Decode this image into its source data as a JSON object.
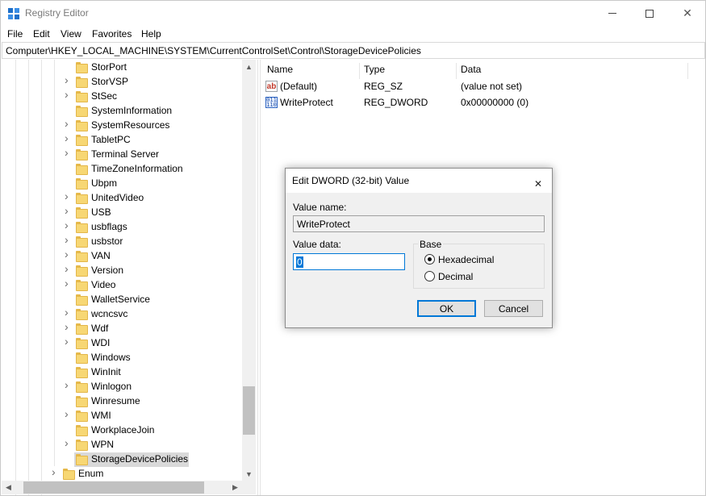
{
  "window": {
    "title": "Registry Editor"
  },
  "titlebar": {
    "minimize_icon": "minimize-icon",
    "maximize_icon": "maximize-icon",
    "close_glyph": "✕"
  },
  "menu": [
    "File",
    "Edit",
    "View",
    "Favorites",
    "Help"
  ],
  "address": "Computer\\HKEY_LOCAL_MACHINE\\SYSTEM\\CurrentControlSet\\Control\\StorageDevicePolicies",
  "tree": {
    "items": [
      {
        "label": "StorPort",
        "expandable": false
      },
      {
        "label": "StorVSP",
        "expandable": true
      },
      {
        "label": "StSec",
        "expandable": true
      },
      {
        "label": "SystemInformation",
        "expandable": false
      },
      {
        "label": "SystemResources",
        "expandable": true
      },
      {
        "label": "TabletPC",
        "expandable": true
      },
      {
        "label": "Terminal Server",
        "expandable": true
      },
      {
        "label": "TimeZoneInformation",
        "expandable": false
      },
      {
        "label": "Ubpm",
        "expandable": false
      },
      {
        "label": "UnitedVideo",
        "expandable": true
      },
      {
        "label": "USB",
        "expandable": true
      },
      {
        "label": "usbflags",
        "expandable": true
      },
      {
        "label": "usbstor",
        "expandable": true
      },
      {
        "label": "VAN",
        "expandable": true
      },
      {
        "label": "Version",
        "expandable": true
      },
      {
        "label": "Video",
        "expandable": true
      },
      {
        "label": "WalletService",
        "expandable": false
      },
      {
        "label": "wcncsvc",
        "expandable": true
      },
      {
        "label": "Wdf",
        "expandable": true
      },
      {
        "label": "WDI",
        "expandable": true
      },
      {
        "label": "Windows",
        "expandable": false
      },
      {
        "label": "WinInit",
        "expandable": false
      },
      {
        "label": "Winlogon",
        "expandable": true
      },
      {
        "label": "Winresume",
        "expandable": false
      },
      {
        "label": "WMI",
        "expandable": true
      },
      {
        "label": "WorkplaceJoin",
        "expandable": false
      },
      {
        "label": "WPN",
        "expandable": true
      },
      {
        "label": "StorageDevicePolicies",
        "expandable": false,
        "selected": true
      }
    ],
    "parent_sibling": {
      "label": "Enum",
      "expandable": true
    }
  },
  "values": {
    "columns": [
      "Name",
      "Type",
      "Data"
    ],
    "rows": [
      {
        "name": "(Default)",
        "type": "REG_SZ",
        "data": "(value not set)",
        "icon": "string-value-icon",
        "glyph": "ab"
      },
      {
        "name": "WriteProtect",
        "type": "REG_DWORD",
        "data": "0x00000000 (0)",
        "icon": "binary-value-icon",
        "glyph": "011\n110"
      }
    ]
  },
  "dialog": {
    "title": "Edit DWORD (32-bit) Value",
    "value_name_label": "Value name:",
    "value_name": "WriteProtect",
    "value_data_label": "Value data:",
    "value_data": "0",
    "base_label": "Base",
    "base_options": [
      {
        "label": "Hexadecimal",
        "checked": true
      },
      {
        "label": "Decimal",
        "checked": false
      }
    ],
    "ok_label": "OK",
    "cancel_label": "Cancel",
    "close_glyph": "✕"
  },
  "colors": {
    "accent": "#0078d7",
    "folder": "#f7d774",
    "selection": "#d9d9d9"
  }
}
